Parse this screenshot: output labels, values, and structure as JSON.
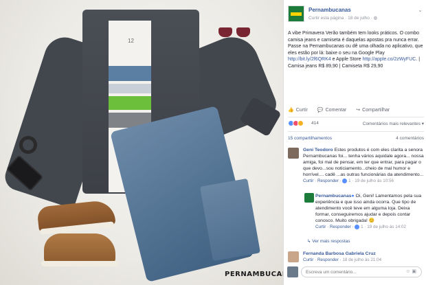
{
  "post": {
    "page_name": "Pernambucanas",
    "meta": "Curtir esta página · 18 de julho · ",
    "text_plain": "A vibe Primavera Verão também tem looks práticos. O combo camisa jeans e camiseta é daquelas apostas pra nunca errar. Passe na Pernambucanas ou dê uma olhada no aplicativo, que eles estão por lá: baixe o seu na Google Play ",
    "link1": "http://bit.ly/2f6QRK4",
    "text_mid": " e Apple Store ",
    "link2": "http://apple.co/2zWyFUC",
    "text_end": ". | Camisa jeans R$ 89,90 | Camiseta R$ 29,90"
  },
  "actions": {
    "like": "Curtir",
    "comment": "Comentar",
    "share": "Compartilhar"
  },
  "reactions": {
    "count": "414",
    "order_label": "Comentários mais relevantes ▾",
    "shares": "15 compartilhamentos",
    "comments_count": "4 comentários",
    "colors": [
      "#5890ff",
      "#f0506e",
      "#f7b125"
    ]
  },
  "comments": [
    {
      "name": "Geni Teodoro",
      "text": " Estes produtos é com eles clarita a senora Pernambucanas foi... tenha vários aquidale agora... nossa amiga, foi mal de pensar, em ter que entrar, para pagar o que devo...sou noticiamento...cheio de mal humor e horrível.... cadê ...as outras funcionárias da atendimento...",
      "actions": "Curtir · Responder · ",
      "likes": "1",
      "time": " · 19 de julho às 10:56"
    },
    {
      "name": "Pernambucanas",
      "text": " Oi, Geni! Lamentamos pela sua experiência e que isso ainda ocorra. Que tipo de atendimento você teve em alguma loja. Deixa formar, conseguiremos ajudar e depois contar conosco. Muito obrigada! ",
      "actions": "Curtir · Responder · ",
      "likes": "1",
      "time": " · 19 de julho às 14:02"
    },
    {
      "name": "Fernanda Barbosa Gabriela Cruz",
      "text": "",
      "actions": "Curtir · Responder · ",
      "likes": "",
      "time": "18 de julho às 21:04"
    }
  ],
  "more_replies": "Ver mais respostas",
  "reply_placeholder": "Escreva um comentário...",
  "watermark": "PERNAMBUCANAS",
  "tee_label": "12"
}
